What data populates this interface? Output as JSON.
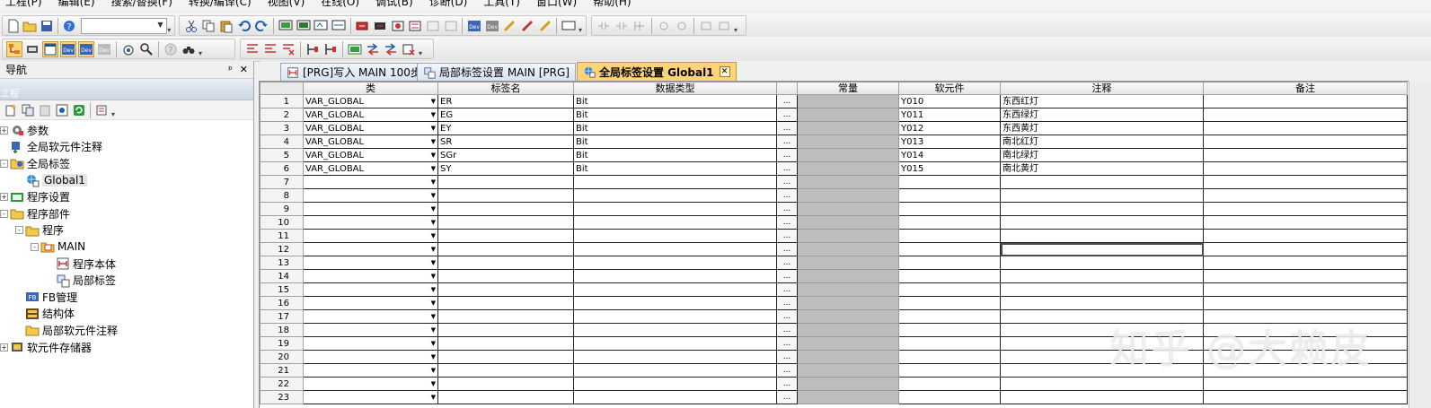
{
  "menu": [
    "工程(P)",
    "编辑(E)",
    "搜索/替换(F)",
    "转换/编译(C)",
    "视图(V)",
    "在线(O)",
    "调试(B)",
    "诊断(D)",
    "工具(T)",
    "窗口(W)",
    "帮助(H)"
  ],
  "nav": {
    "title": "导航",
    "pin": "ᵖ",
    "close": "✕",
    "subheader": "工程",
    "tree": [
      {
        "label": "参数",
        "level": 0,
        "exp": "+",
        "icon": "gear-icon"
      },
      {
        "label": "全局软元件注释",
        "level": 0,
        "exp": "",
        "icon": "comment-icon"
      },
      {
        "label": "全局标签",
        "level": 0,
        "exp": "-",
        "icon": "label-folder-icon"
      },
      {
        "label": "Global1",
        "level": 1,
        "exp": "",
        "icon": "global-label-icon",
        "selected": true
      },
      {
        "label": "程序设置",
        "level": 0,
        "exp": "+",
        "icon": "program-setting-icon"
      },
      {
        "label": "程序部件",
        "level": 0,
        "exp": "-",
        "icon": "folder-icon"
      },
      {
        "label": "程序",
        "level": 1,
        "exp": "-",
        "icon": "folder-icon"
      },
      {
        "label": "MAIN",
        "level": 2,
        "exp": "-",
        "icon": "program-icon"
      },
      {
        "label": "程序本体",
        "level": 3,
        "exp": "",
        "icon": "ladder-icon"
      },
      {
        "label": "局部标签",
        "level": 3,
        "exp": "",
        "icon": "local-label-icon"
      },
      {
        "label": "FB管理",
        "level": 1,
        "exp": "",
        "icon": "fb-icon"
      },
      {
        "label": "结构体",
        "level": 1,
        "exp": "",
        "icon": "struct-icon"
      },
      {
        "label": "局部软元件注释",
        "level": 1,
        "exp": "",
        "icon": "folder-icon"
      },
      {
        "label": "软元件存储器",
        "level": 0,
        "exp": "+",
        "icon": "memory-icon"
      }
    ]
  },
  "tabs": [
    {
      "label": "[PRG]写入 MAIN 100步",
      "active": false
    },
    {
      "label": "局部标签设置 MAIN [PRG]",
      "active": false
    },
    {
      "label": "全局标签设置 Global1",
      "active": true
    }
  ],
  "tab_close": "✕",
  "grid": {
    "headers": [
      "类",
      "标签名",
      "数据类型",
      "",
      "常量",
      "软元件",
      "注释",
      "备注"
    ],
    "default_class": "VAR_GLOBAL",
    "dots": "...",
    "rows": [
      {
        "no": "1",
        "class": "VAR_GLOBAL",
        "name": "ER",
        "type": "Bit",
        "device": "Y010",
        "comment": "东西红灯"
      },
      {
        "no": "2",
        "class": "VAR_GLOBAL",
        "name": "EG",
        "type": "Bit",
        "device": "Y011",
        "comment": "东西绿灯"
      },
      {
        "no": "3",
        "class": "VAR_GLOBAL",
        "name": "EY",
        "type": "Bit",
        "device": "Y012",
        "comment": "东西黄灯"
      },
      {
        "no": "4",
        "class": "VAR_GLOBAL",
        "name": "SR",
        "type": "Bit",
        "device": "Y013",
        "comment": "南北红灯"
      },
      {
        "no": "5",
        "class": "VAR_GLOBAL",
        "name": "SGr",
        "type": "Bit",
        "device": "Y014",
        "comment": "南北绿灯"
      },
      {
        "no": "6",
        "class": "VAR_GLOBAL",
        "name": "SY",
        "type": "Bit",
        "device": "Y015",
        "comment": "南北黄灯"
      },
      {
        "no": "7",
        "class": "",
        "name": "",
        "type": "",
        "device": "",
        "comment": ""
      },
      {
        "no": "8",
        "class": "",
        "name": "",
        "type": "",
        "device": "",
        "comment": ""
      },
      {
        "no": "9",
        "class": "",
        "name": "",
        "type": "",
        "device": "",
        "comment": ""
      },
      {
        "no": "10",
        "class": "",
        "name": "",
        "type": "",
        "device": "",
        "comment": ""
      },
      {
        "no": "11",
        "class": "",
        "name": "",
        "type": "",
        "device": "",
        "comment": ""
      },
      {
        "no": "12",
        "class": "",
        "name": "",
        "type": "",
        "device": "",
        "comment": "",
        "focus": true
      },
      {
        "no": "13",
        "class": "",
        "name": "",
        "type": "",
        "device": "",
        "comment": ""
      },
      {
        "no": "14",
        "class": "",
        "name": "",
        "type": "",
        "device": "",
        "comment": ""
      },
      {
        "no": "15",
        "class": "",
        "name": "",
        "type": "",
        "device": "",
        "comment": ""
      },
      {
        "no": "16",
        "class": "",
        "name": "",
        "type": "",
        "device": "",
        "comment": ""
      },
      {
        "no": "17",
        "class": "",
        "name": "",
        "type": "",
        "device": "",
        "comment": ""
      },
      {
        "no": "18",
        "class": "",
        "name": "",
        "type": "",
        "device": "",
        "comment": ""
      },
      {
        "no": "19",
        "class": "",
        "name": "",
        "type": "",
        "device": "",
        "comment": ""
      },
      {
        "no": "20",
        "class": "",
        "name": "",
        "type": "",
        "device": "",
        "comment": ""
      },
      {
        "no": "21",
        "class": "",
        "name": "",
        "type": "",
        "device": "",
        "comment": ""
      },
      {
        "no": "22",
        "class": "",
        "name": "",
        "type": "",
        "device": "",
        "comment": ""
      },
      {
        "no": "23",
        "class": "",
        "name": "",
        "type": "",
        "device": "",
        "comment": ""
      }
    ]
  },
  "watermark": "知乎 @大赖皮",
  "colors": {
    "active_tab": "#ffd37a",
    "constant_column": "#bdbdbd",
    "nav_subheader": "#cdd6e3"
  }
}
